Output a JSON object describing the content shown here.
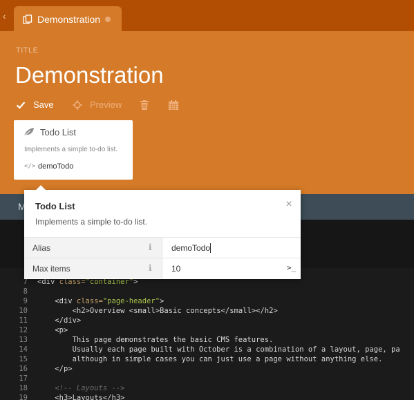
{
  "tab": {
    "title": "Demonstration"
  },
  "header": {
    "field_label": "TITLE",
    "title": "Demonstration"
  },
  "toolbar": {
    "save_label": "Save",
    "preview_label": "Preview",
    "icons": [
      "check-icon",
      "crosshair-icon",
      "trash-icon",
      "calendar-icon"
    ]
  },
  "component_card": {
    "name": "Todo List",
    "description": "Implements a simple to-do list.",
    "alias_icon": "</>",
    "alias": "demoTodo"
  },
  "secondary_bar": {
    "visible_label": "M"
  },
  "inspector": {
    "title": "Todo List",
    "description": "Implements a simple to-do list.",
    "close_symbol": "×",
    "properties": [
      {
        "label": "Alias",
        "value": "demoTodo"
      },
      {
        "label": "Max items",
        "value": "10",
        "suffix": ">_"
      }
    ]
  },
  "editor": {
    "lines": [
      {
        "n": "7",
        "text": "<div class=\"container\">"
      },
      {
        "n": "8",
        "text": ""
      },
      {
        "n": "9",
        "text": "    <div class=\"page-header\">"
      },
      {
        "n": "10",
        "text": "        <h2>Overview <small>Basic concepts</small></h2>"
      },
      {
        "n": "11",
        "text": "    </div>"
      },
      {
        "n": "12",
        "text": "    <p>"
      },
      {
        "n": "13",
        "text": "        This page demonstrates the basic CMS features."
      },
      {
        "n": "14",
        "text": "        Usually each page built with October is a combination of a layout, page, pa"
      },
      {
        "n": "15",
        "text": "        although in simple cases you can just use a page without anything else."
      },
      {
        "n": "16",
        "text": "    </p>"
      },
      {
        "n": "17",
        "text": ""
      },
      {
        "n": "18",
        "text": "    <!-- Layouts -->"
      },
      {
        "n": "19",
        "text": "    <h3>Layouts</h3>"
      }
    ]
  },
  "colors": {
    "brand_orange": "#d47a28",
    "tab_bar": "#b24e04",
    "secondary_bar": "#3d4c56",
    "editor_bg": "#1b1b1b"
  }
}
